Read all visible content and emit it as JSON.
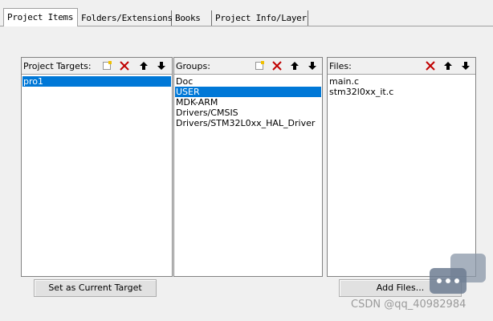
{
  "tabs": [
    {
      "label": "Project Items",
      "active": true
    },
    {
      "label": "Folders/Extensions",
      "active": false
    },
    {
      "label": "Books",
      "active": false
    },
    {
      "label": "Project Info/Layer",
      "active": false
    }
  ],
  "panels": {
    "targets": {
      "title": "Project Targets:",
      "items": [
        "pro1"
      ],
      "selected_index": 0
    },
    "groups": {
      "title": "Groups:",
      "items": [
        "Doc",
        "USER",
        "MDK-ARM",
        "Drivers/CMSIS",
        "Drivers/STM32L0xx_HAL_Driver"
      ],
      "selected_index": 1
    },
    "files": {
      "title": "Files:",
      "items": [
        "main.c",
        "stm32l0xx_it.c"
      ],
      "selected_index": -1
    }
  },
  "buttons": {
    "set_current_target": "Set as Current Target",
    "add_files": "Add Files..."
  },
  "watermark": "CSDN @qq_40982984",
  "icons": [
    "new-icon",
    "delete-icon",
    "move-up-icon",
    "move-down-icon",
    "chat-icon"
  ],
  "colors": {
    "selection": "#0078d7",
    "delete": "#c00000",
    "background": "#f0f0f0"
  }
}
